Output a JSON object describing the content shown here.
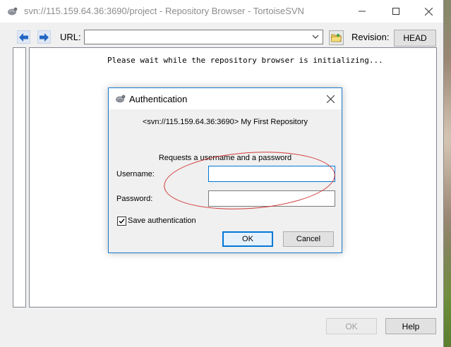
{
  "window": {
    "title": "svn://115.159.64.36:3690/project - Repository Browser - TortoiseSVN",
    "icon": "tortoisesvn-icon",
    "controls": [
      "minimize-icon",
      "maximize-icon",
      "close-icon"
    ]
  },
  "toolbar": {
    "url_label": "URL:",
    "url_value": "",
    "revision_label": "Revision:",
    "head_label": "HEAD"
  },
  "main": {
    "status_text": "Please wait while the repository browser is initializing..."
  },
  "footer": {
    "ok_label": "OK",
    "help_label": "Help"
  },
  "dialog": {
    "title": "Authentication",
    "realm": "<svn://115.159.64.36:3690> My First Repository",
    "request_text": "Requests a username and a password",
    "username_label": "Username:",
    "username_value": "",
    "password_label": "Password:",
    "password_value": "",
    "save_auth_label": "Save authentication",
    "save_auth_checked": true,
    "ok_label": "OK",
    "cancel_label": "Cancel"
  },
  "colors": {
    "accent": "#0078d7",
    "annotation": "#d23a3a",
    "nav_arrow": "#2166c4"
  }
}
